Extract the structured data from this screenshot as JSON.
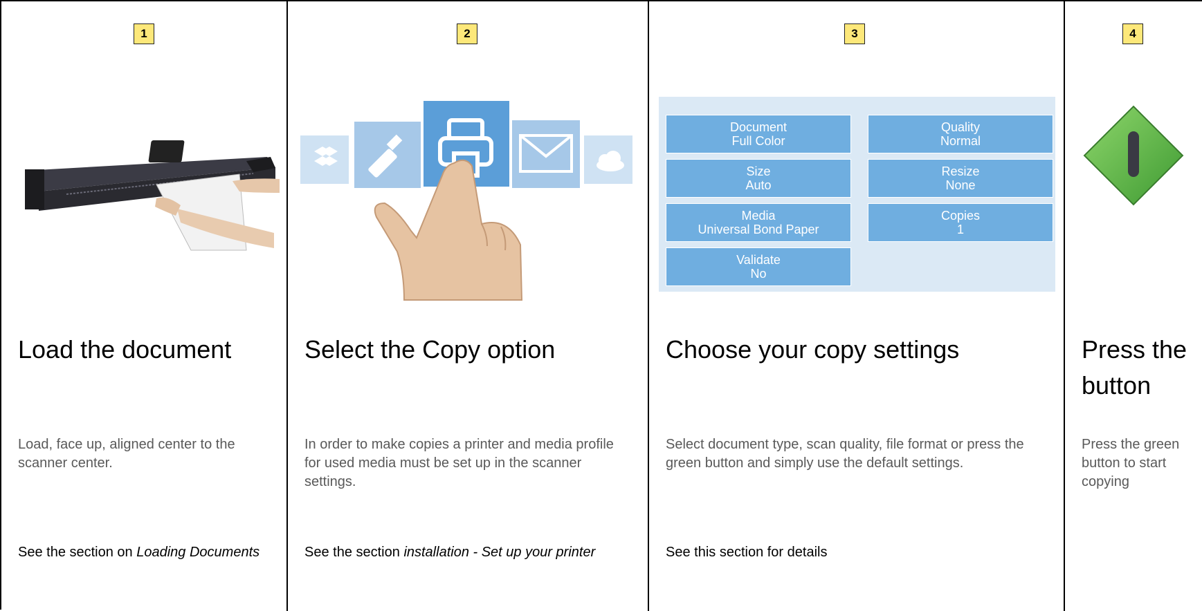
{
  "steps": [
    {
      "number": "1",
      "title": "Load the document",
      "description": "Load, face up, aligned center to the scanner center.",
      "see_prefix": "See the section on ",
      "see_link": "Loading Documents"
    },
    {
      "number": "2",
      "title": "Select the Copy option",
      "description": "In order to make copies a printer and media profile for used media must be set up in the scanner settings.",
      "see_prefix": "See the section ",
      "see_link": "installation - Set up your printer"
    },
    {
      "number": "3",
      "title": "Choose your copy settings",
      "description": "Select document type, scan quality, file format or press the green button and simply use the default settings.",
      "see_prefix": "See this section for details",
      "see_link": ""
    },
    {
      "number": "4",
      "title": "Press the button",
      "description": "Press the green button to start copying",
      "see_prefix": "",
      "see_link": ""
    }
  ],
  "settings_tiles": [
    {
      "label": "Document",
      "value": "Full Color"
    },
    {
      "label": "Quality",
      "value": "Normal"
    },
    {
      "label": "Size",
      "value": "Auto"
    },
    {
      "label": "Resize",
      "value": "None"
    },
    {
      "label": "Media",
      "value": "Universal Bond Paper"
    },
    {
      "label": "Copies",
      "value": "1"
    },
    {
      "label": "Validate",
      "value": "No"
    }
  ],
  "icons": [
    "dropbox-icon",
    "usb-icon",
    "printer-icon",
    "email-icon",
    "cloud-icon",
    "hand-pointer-icon",
    "scanner-image",
    "green-start-button-icon"
  ],
  "colors": {
    "badge": "#fde87a",
    "tile": "#6faee0",
    "panel": "#dbe9f5",
    "green_button": "#5cb848",
    "desc_text": "#595959"
  }
}
